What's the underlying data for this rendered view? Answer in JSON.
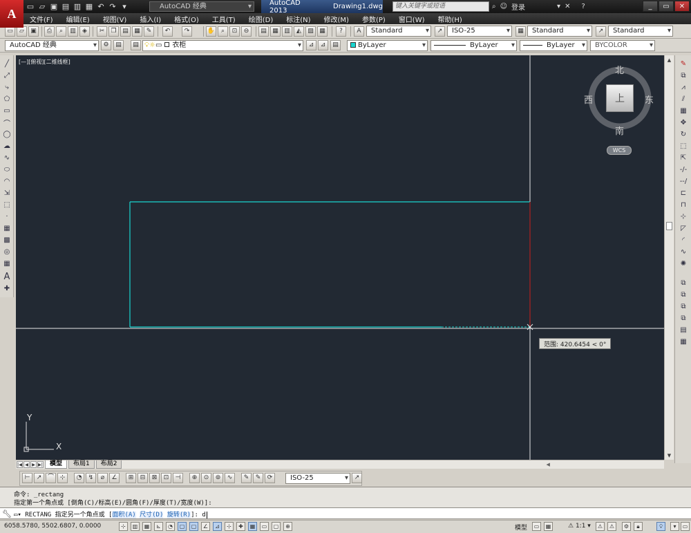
{
  "titlebar": {
    "logo": "A",
    "workspace": "AutoCAD 经典",
    "app_name": "AutoCAD 2013",
    "document": "Drawing1.dwg",
    "search_placeholder": "键入关键字或短语",
    "login": "登录"
  },
  "menu": [
    "文件(F)",
    "编辑(E)",
    "视图(V)",
    "插入(I)",
    "格式(O)",
    "工具(T)",
    "绘图(D)",
    "标注(N)",
    "修改(M)",
    "参数(P)",
    "窗口(W)",
    "帮助(H)"
  ],
  "toolbar1": {
    "text_style": "Standard",
    "dim_style": "ISO-25",
    "table_style": "Standard",
    "mleader_style": "Standard"
  },
  "toolbar2": {
    "workspace": "AutoCAD 经典",
    "layer": "衣柜",
    "color": "ByLayer",
    "linetype": "ByLayer",
    "lineweight": "ByLayer",
    "plotstyle": "BYCOLOR"
  },
  "canvas": {
    "viewport_label": "[—][俯视][二维线框]",
    "background": "#222933",
    "rect_color": "#19d6d1",
    "tooltip": "范围: 420.6454 < 0°"
  },
  "viewcube": {
    "north": "北",
    "south": "南",
    "east": "东",
    "west": "西",
    "top": "上",
    "wcs": "WCS"
  },
  "ucs": {
    "x": "X",
    "y": "Y"
  },
  "layout_tabs": [
    "模型",
    "布局1",
    "布局2"
  ],
  "dim_toolbar": {
    "dim_style": "ISO-25"
  },
  "command": {
    "history1": "命令: _rectang",
    "history2": "指定第一个角点或 [倒角(C)/标高(E)/圆角(F)/厚度(T)/宽度(W)]:",
    "prompt_prefix": "RECTANG 指定另一个角点或 [",
    "opt_area": "面积(A)",
    "opt_dims": "尺寸(D)",
    "opt_rotate": "旋转(R)",
    "prompt_suffix": "]: ",
    "typed": "d"
  },
  "statusbar": {
    "coords": "6058.5780, 5502.6807, 0.0000",
    "model": "模型",
    "scale": "1:1"
  }
}
